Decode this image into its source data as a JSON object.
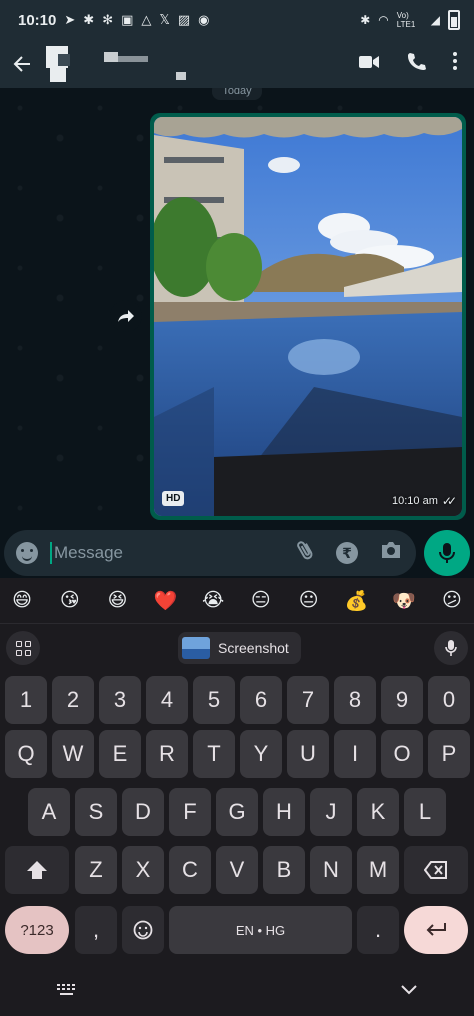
{
  "status_bar": {
    "time": "10:10",
    "network_label": "Vo) LTE1",
    "left_icons": [
      "telegram-icon",
      "slack-icon",
      "settings-fan-icon",
      "notes-icon",
      "drive-icon",
      "x-icon",
      "gallery-icon",
      "whatsapp-status-icon"
    ],
    "right_icons": [
      "bluetooth-icon",
      "wifi-icon",
      "signal-icon",
      "battery-icon"
    ]
  },
  "header": {
    "contact_name": "",
    "actions": [
      "video-call-icon",
      "voice-call-icon",
      "more-icon"
    ]
  },
  "chat": {
    "date_chip": "Today",
    "image_message": {
      "badge": "HD",
      "time": "10:10 am",
      "status": "read"
    }
  },
  "composer": {
    "placeholder": "Message",
    "icons": [
      "emoji-icon",
      "attach-icon",
      "rupee-icon",
      "camera-icon",
      "mic-icon"
    ]
  },
  "keyboard": {
    "emoji_suggestions": [
      "😄",
      "😘",
      "😆",
      "❤️",
      "😭",
      "😑",
      "😐",
      "💰",
      "🐶",
      "😕"
    ],
    "suggestion_chip": "Screenshot",
    "number_row": [
      "1",
      "2",
      "3",
      "4",
      "5",
      "6",
      "7",
      "8",
      "9",
      "0"
    ],
    "row1": [
      "Q",
      "W",
      "E",
      "R",
      "T",
      "Y",
      "U",
      "I",
      "O",
      "P"
    ],
    "row2": [
      "A",
      "S",
      "D",
      "F",
      "G",
      "H",
      "J",
      "K",
      "L"
    ],
    "row3": [
      "Z",
      "X",
      "C",
      "V",
      "B",
      "N",
      "M"
    ],
    "symbols_label": "?123",
    "comma_label": ",",
    "space_label": "EN • HG",
    "period_label": ".",
    "colors": {
      "accent": "#00a884",
      "enter": "#f6d9d7",
      "symbols": "#e5c3c3"
    }
  }
}
